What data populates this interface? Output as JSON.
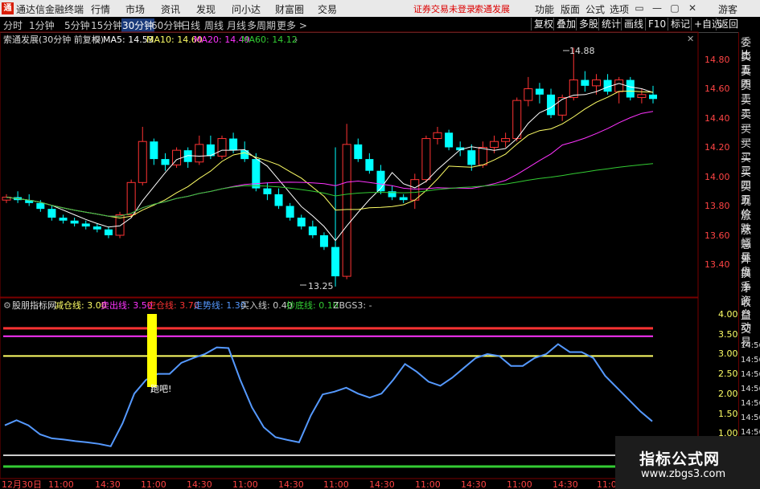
{
  "app": {
    "logo": "通",
    "title": "通达信金融终端"
  },
  "menu": [
    "行情",
    "市场",
    "资讯",
    "发现",
    "问小达",
    "财富圈",
    "交易"
  ],
  "status": {
    "login": "证券交易未登录",
    "stock": "索通发展"
  },
  "right_menu": [
    "功能",
    "版面",
    "公式",
    "选项"
  ],
  "guest": "游客",
  "window_buttons": [
    "▭",
    "—",
    "▢",
    "✕"
  ],
  "periods": [
    "分时",
    "1分钟",
    "5分钟",
    "15分钟",
    "30分钟",
    "60分钟",
    "日线",
    "周线",
    "月线",
    "多周期",
    "更多 >"
  ],
  "active_period": 4,
  "toolbar": [
    "复权",
    "叠加",
    "多股",
    "统计",
    "画线",
    "F10",
    "标记",
    "+自选",
    "返回"
  ],
  "main_chart": {
    "stock_title": "索通发展(30分钟 前复权)",
    "ma": [
      {
        "label": "MA5: 14.53",
        "color": "#ffffff"
      },
      {
        "label": "MA10: 14.60",
        "color": "#ffff66"
      },
      {
        "label": "MA20: 14.49",
        "color": "#ff33ff"
      },
      {
        "label": "MA60: 14.12",
        "color": "#33cc33"
      }
    ],
    "high_label": "14.88",
    "low_label": "13.25",
    "y_ticks": [
      "14.80",
      "14.60",
      "14.40",
      "14.20",
      "14.00",
      "13.80",
      "13.60",
      "13.40"
    ]
  },
  "indicator": {
    "name": "股朋指标网",
    "items": [
      {
        "label": "减仓线: 3.00",
        "color": "#ffff66"
      },
      {
        "label": "卖出线: 3.50",
        "color": "#ff33ff"
      },
      {
        "label": "空仓线: 3.70",
        "color": "#ff3333"
      },
      {
        "label": "走势线: 1.30",
        "color": "#5599ff"
      },
      {
        "label": "买入线: 0.40",
        "color": "#cccccc"
      },
      {
        "label": "抄底线: 0.10",
        "color": "#33cc33"
      },
      {
        "label": "ZBGS3: -",
        "color": "#cccccc"
      }
    ],
    "signal_text": "跑吧!",
    "y_ticks": [
      "4.00",
      "3.50",
      "3.00",
      "2.50",
      "2.00",
      "1.50",
      "1.00"
    ]
  },
  "x_axis": [
    "12月30日",
    "11:00",
    "14:30",
    "11:00",
    "14:30",
    "11:00",
    "14:30",
    "11:00",
    "14:30",
    "11:00",
    "14:30",
    "11:00",
    "14:30",
    "11:00"
  ],
  "sidebar_top": [
    "委比",
    "卖五",
    "卖四",
    "卖三",
    "卖二",
    "卖一",
    "买一",
    "买二",
    "买三",
    "买四",
    "买五",
    "现价",
    "涨跌",
    "涨幅",
    "总量",
    "外盘",
    "换手",
    "净资",
    "收益"
  ],
  "sidebar_bottom": [
    "自动",
    "交易"
  ],
  "sidebar_times": [
    "14:56",
    "14:56",
    "14:56",
    "14:56",
    "14:56",
    "14:56",
    "14:56",
    "14:56"
  ],
  "watermark": {
    "title": "指标公式网",
    "url": "www.zbgs3.com"
  },
  "chart_data": {
    "type": "candlestick",
    "candles": [
      [
        13.84,
        13.88,
        13.82,
        13.86
      ],
      [
        13.86,
        13.9,
        13.82,
        13.84
      ],
      [
        13.84,
        13.88,
        13.8,
        13.82
      ],
      [
        13.82,
        13.84,
        13.76,
        13.78
      ],
      [
        13.78,
        13.8,
        13.7,
        13.72
      ],
      [
        13.72,
        13.74,
        13.68,
        13.7
      ],
      [
        13.7,
        13.72,
        13.66,
        13.68
      ],
      [
        13.68,
        13.7,
        13.64,
        13.66
      ],
      [
        13.66,
        13.68,
        13.62,
        13.64
      ],
      [
        13.64,
        13.66,
        13.58,
        13.6
      ],
      [
        13.6,
        13.76,
        13.58,
        13.74
      ],
      [
        13.74,
        13.98,
        13.72,
        13.96
      ],
      [
        13.96,
        14.34,
        13.94,
        14.24
      ],
      [
        14.24,
        14.26,
        14.08,
        14.12
      ],
      [
        14.12,
        14.16,
        14.04,
        14.08
      ],
      [
        14.08,
        14.2,
        14.06,
        14.18
      ],
      [
        14.18,
        14.2,
        14.06,
        14.1
      ],
      [
        14.1,
        14.28,
        14.08,
        14.22
      ],
      [
        14.22,
        14.28,
        14.12,
        14.14
      ],
      [
        14.14,
        14.28,
        14.12,
        14.26
      ],
      [
        14.26,
        14.3,
        14.16,
        14.18
      ],
      [
        14.18,
        14.24,
        14.1,
        14.12
      ],
      [
        14.12,
        14.16,
        13.9,
        13.92
      ],
      [
        13.92,
        13.96,
        13.84,
        13.88
      ],
      [
        13.88,
        13.92,
        13.78,
        13.8
      ],
      [
        13.8,
        13.82,
        13.7,
        13.72
      ],
      [
        13.72,
        13.74,
        13.64,
        13.66
      ],
      [
        13.66,
        13.7,
        13.58,
        13.6
      ],
      [
        13.6,
        13.62,
        13.5,
        13.52
      ],
      [
        13.52,
        14.2,
        13.25,
        13.32
      ],
      [
        13.32,
        14.36,
        13.3,
        14.22
      ],
      [
        14.22,
        14.26,
        14.1,
        14.12
      ],
      [
        14.12,
        14.16,
        14.02,
        14.04
      ],
      [
        14.04,
        14.08,
        13.88,
        13.9
      ],
      [
        13.9,
        13.94,
        13.84,
        13.86
      ],
      [
        13.86,
        13.88,
        13.82,
        13.84
      ],
      [
        13.84,
        14.02,
        13.78,
        13.98
      ],
      [
        13.98,
        14.28,
        13.96,
        14.26
      ],
      [
        14.26,
        14.34,
        14.22,
        14.3
      ],
      [
        14.3,
        14.32,
        14.18,
        14.2
      ],
      [
        14.2,
        14.24,
        14.14,
        14.18
      ],
      [
        14.18,
        14.22,
        14.04,
        14.08
      ],
      [
        14.08,
        14.24,
        14.06,
        14.2
      ],
      [
        14.2,
        14.28,
        14.16,
        14.24
      ],
      [
        14.24,
        14.3,
        14.2,
        14.26
      ],
      [
        14.26,
        14.54,
        14.24,
        14.52
      ],
      [
        14.52,
        14.68,
        14.48,
        14.6
      ],
      [
        14.6,
        14.64,
        14.5,
        14.56
      ],
      [
        14.56,
        14.6,
        14.4,
        14.42
      ],
      [
        14.42,
        14.56,
        14.38,
        14.54
      ],
      [
        14.54,
        14.88,
        14.52,
        14.66
      ],
      [
        14.66,
        14.72,
        14.58,
        14.62
      ],
      [
        14.62,
        14.7,
        14.56,
        14.66
      ],
      [
        14.66,
        14.7,
        14.56,
        14.58
      ],
      [
        14.58,
        14.68,
        14.5,
        14.66
      ],
      [
        14.66,
        14.68,
        14.52,
        14.54
      ],
      [
        14.54,
        14.6,
        14.5,
        14.56
      ],
      [
        14.56,
        14.62,
        14.5,
        14.53
      ]
    ],
    "trend_line": [
      1.25,
      1.38,
      1.25,
      1.02,
      0.92,
      0.89,
      0.85,
      0.82,
      0.78,
      0.72,
      1.3,
      2.05,
      2.4,
      2.55,
      2.55,
      2.83,
      2.95,
      3.05,
      3.22,
      3.2,
      2.4,
      1.7,
      1.2,
      0.95,
      0.88,
      0.82,
      1.5,
      2.03,
      2.1,
      2.2,
      2.05,
      1.95,
      2.05,
      2.4,
      2.8,
      2.6,
      2.35,
      2.25,
      2.45,
      2.7,
      2.95,
      3.05,
      3.0,
      2.75,
      2.75,
      2.95,
      3.05,
      3.3,
      3.1,
      3.1,
      2.95,
      2.5,
      2.2,
      1.9,
      1.6,
      1.35
    ],
    "levels": {
      "减仓线": 3.0,
      "卖出线": 3.5,
      "空仓线": 3.7,
      "买入线": 0.4,
      "抄底线": 0.1
    }
  }
}
